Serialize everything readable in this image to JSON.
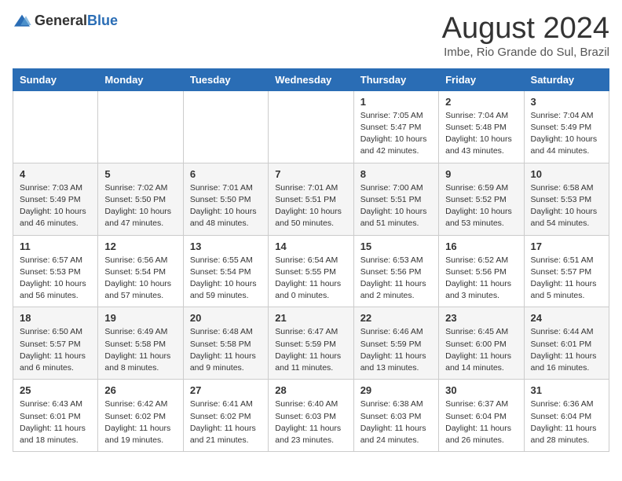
{
  "logo": {
    "general": "General",
    "blue": "Blue"
  },
  "header": {
    "title": "August 2024",
    "subtitle": "Imbe, Rio Grande do Sul, Brazil"
  },
  "weekdays": [
    "Sunday",
    "Monday",
    "Tuesday",
    "Wednesday",
    "Thursday",
    "Friday",
    "Saturday"
  ],
  "weeks": [
    [
      {
        "day": "",
        "info": ""
      },
      {
        "day": "",
        "info": ""
      },
      {
        "day": "",
        "info": ""
      },
      {
        "day": "",
        "info": ""
      },
      {
        "day": "1",
        "info": "Sunrise: 7:05 AM\nSunset: 5:47 PM\nDaylight: 10 hours\nand 42 minutes."
      },
      {
        "day": "2",
        "info": "Sunrise: 7:04 AM\nSunset: 5:48 PM\nDaylight: 10 hours\nand 43 minutes."
      },
      {
        "day": "3",
        "info": "Sunrise: 7:04 AM\nSunset: 5:49 PM\nDaylight: 10 hours\nand 44 minutes."
      }
    ],
    [
      {
        "day": "4",
        "info": "Sunrise: 7:03 AM\nSunset: 5:49 PM\nDaylight: 10 hours\nand 46 minutes."
      },
      {
        "day": "5",
        "info": "Sunrise: 7:02 AM\nSunset: 5:50 PM\nDaylight: 10 hours\nand 47 minutes."
      },
      {
        "day": "6",
        "info": "Sunrise: 7:01 AM\nSunset: 5:50 PM\nDaylight: 10 hours\nand 48 minutes."
      },
      {
        "day": "7",
        "info": "Sunrise: 7:01 AM\nSunset: 5:51 PM\nDaylight: 10 hours\nand 50 minutes."
      },
      {
        "day": "8",
        "info": "Sunrise: 7:00 AM\nSunset: 5:51 PM\nDaylight: 10 hours\nand 51 minutes."
      },
      {
        "day": "9",
        "info": "Sunrise: 6:59 AM\nSunset: 5:52 PM\nDaylight: 10 hours\nand 53 minutes."
      },
      {
        "day": "10",
        "info": "Sunrise: 6:58 AM\nSunset: 5:53 PM\nDaylight: 10 hours\nand 54 minutes."
      }
    ],
    [
      {
        "day": "11",
        "info": "Sunrise: 6:57 AM\nSunset: 5:53 PM\nDaylight: 10 hours\nand 56 minutes."
      },
      {
        "day": "12",
        "info": "Sunrise: 6:56 AM\nSunset: 5:54 PM\nDaylight: 10 hours\nand 57 minutes."
      },
      {
        "day": "13",
        "info": "Sunrise: 6:55 AM\nSunset: 5:54 PM\nDaylight: 10 hours\nand 59 minutes."
      },
      {
        "day": "14",
        "info": "Sunrise: 6:54 AM\nSunset: 5:55 PM\nDaylight: 11 hours\nand 0 minutes."
      },
      {
        "day": "15",
        "info": "Sunrise: 6:53 AM\nSunset: 5:56 PM\nDaylight: 11 hours\nand 2 minutes."
      },
      {
        "day": "16",
        "info": "Sunrise: 6:52 AM\nSunset: 5:56 PM\nDaylight: 11 hours\nand 3 minutes."
      },
      {
        "day": "17",
        "info": "Sunrise: 6:51 AM\nSunset: 5:57 PM\nDaylight: 11 hours\nand 5 minutes."
      }
    ],
    [
      {
        "day": "18",
        "info": "Sunrise: 6:50 AM\nSunset: 5:57 PM\nDaylight: 11 hours\nand 6 minutes."
      },
      {
        "day": "19",
        "info": "Sunrise: 6:49 AM\nSunset: 5:58 PM\nDaylight: 11 hours\nand 8 minutes."
      },
      {
        "day": "20",
        "info": "Sunrise: 6:48 AM\nSunset: 5:58 PM\nDaylight: 11 hours\nand 9 minutes."
      },
      {
        "day": "21",
        "info": "Sunrise: 6:47 AM\nSunset: 5:59 PM\nDaylight: 11 hours\nand 11 minutes."
      },
      {
        "day": "22",
        "info": "Sunrise: 6:46 AM\nSunset: 5:59 PM\nDaylight: 11 hours\nand 13 minutes."
      },
      {
        "day": "23",
        "info": "Sunrise: 6:45 AM\nSunset: 6:00 PM\nDaylight: 11 hours\nand 14 minutes."
      },
      {
        "day": "24",
        "info": "Sunrise: 6:44 AM\nSunset: 6:01 PM\nDaylight: 11 hours\nand 16 minutes."
      }
    ],
    [
      {
        "day": "25",
        "info": "Sunrise: 6:43 AM\nSunset: 6:01 PM\nDaylight: 11 hours\nand 18 minutes."
      },
      {
        "day": "26",
        "info": "Sunrise: 6:42 AM\nSunset: 6:02 PM\nDaylight: 11 hours\nand 19 minutes."
      },
      {
        "day": "27",
        "info": "Sunrise: 6:41 AM\nSunset: 6:02 PM\nDaylight: 11 hours\nand 21 minutes."
      },
      {
        "day": "28",
        "info": "Sunrise: 6:40 AM\nSunset: 6:03 PM\nDaylight: 11 hours\nand 23 minutes."
      },
      {
        "day": "29",
        "info": "Sunrise: 6:38 AM\nSunset: 6:03 PM\nDaylight: 11 hours\nand 24 minutes."
      },
      {
        "day": "30",
        "info": "Sunrise: 6:37 AM\nSunset: 6:04 PM\nDaylight: 11 hours\nand 26 minutes."
      },
      {
        "day": "31",
        "info": "Sunrise: 6:36 AM\nSunset: 6:04 PM\nDaylight: 11 hours\nand 28 minutes."
      }
    ]
  ]
}
